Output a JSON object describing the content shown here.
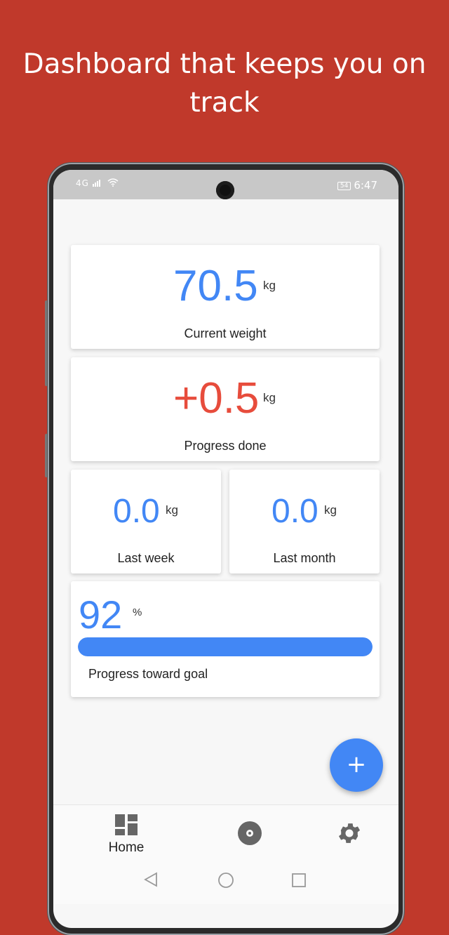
{
  "headline": "Dashboard that keeps you on track",
  "status_bar": {
    "signal": "4G",
    "battery": "54",
    "time": "6:47"
  },
  "cards": {
    "current_weight": {
      "value": "70.5",
      "unit": "kg",
      "label": "Current weight"
    },
    "progress_done": {
      "value": "+0.5",
      "unit": "kg",
      "label": "Progress done"
    },
    "last_week": {
      "value": "0.0",
      "unit": "kg",
      "label": "Last week"
    },
    "last_month": {
      "value": "0.0",
      "unit": "kg",
      "label": "Last month"
    },
    "goal": {
      "value": "92",
      "unit": "%",
      "label": "Progress toward goal",
      "progress_fraction": 1.0
    }
  },
  "fab": {
    "label": "+"
  },
  "bottom_nav": {
    "home_label": "Home",
    "icons": [
      "dashboard-icon",
      "disc-icon",
      "gear-icon"
    ]
  },
  "colors": {
    "background": "#c0392b",
    "accent_blue": "#4287f5",
    "accent_red": "#e74c3c"
  }
}
